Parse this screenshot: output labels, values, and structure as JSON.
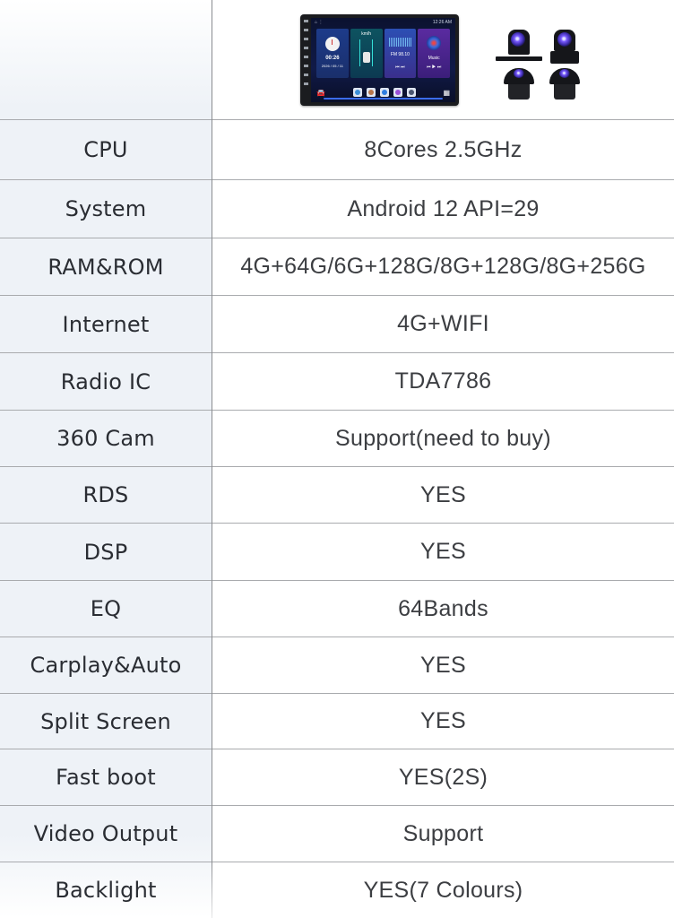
{
  "header": {
    "product_image": "car-stereo-head-unit-with-360-cameras",
    "head_unit_screen": {
      "status_time": "12:26 AM",
      "clock_time": "00:26",
      "date": "2026 / 05 / 11",
      "speed_unit": "km/h",
      "radio": "FM 98.10",
      "music_label": "Music"
    },
    "camera_count": 4
  },
  "specs": [
    {
      "label": "CPU",
      "value": "8Cores  2.5GHz"
    },
    {
      "label": "System",
      "value": "Android 12  API=29"
    },
    {
      "label": "RAM&ROM",
      "value": "4G+64G/6G+128G/8G+128G/8G+256G"
    },
    {
      "label": "Internet",
      "value": "4G+WIFI"
    },
    {
      "label": "Radio IC",
      "value": "TDA7786"
    },
    {
      "label": "360 Cam",
      "value": "Support(need to buy)"
    },
    {
      "label": "RDS",
      "value": "YES"
    },
    {
      "label": "DSP",
      "value": "YES"
    },
    {
      "label": "EQ",
      "value": "64Bands"
    },
    {
      "label": "Carplay&Auto",
      "value": "YES"
    },
    {
      "label": "Split Screen",
      "value": "YES"
    },
    {
      "label": "Fast boot",
      "value": "YES(2S)"
    },
    {
      "label": "Video Output",
      "value": "Support"
    },
    {
      "label": "Backlight",
      "value": "YES(7 Colours)"
    }
  ],
  "colors": {
    "label_column_bg": "#eef2f7",
    "border": "#a9abae",
    "label_text": "#2a2d33",
    "value_text": "#3c3e42"
  }
}
